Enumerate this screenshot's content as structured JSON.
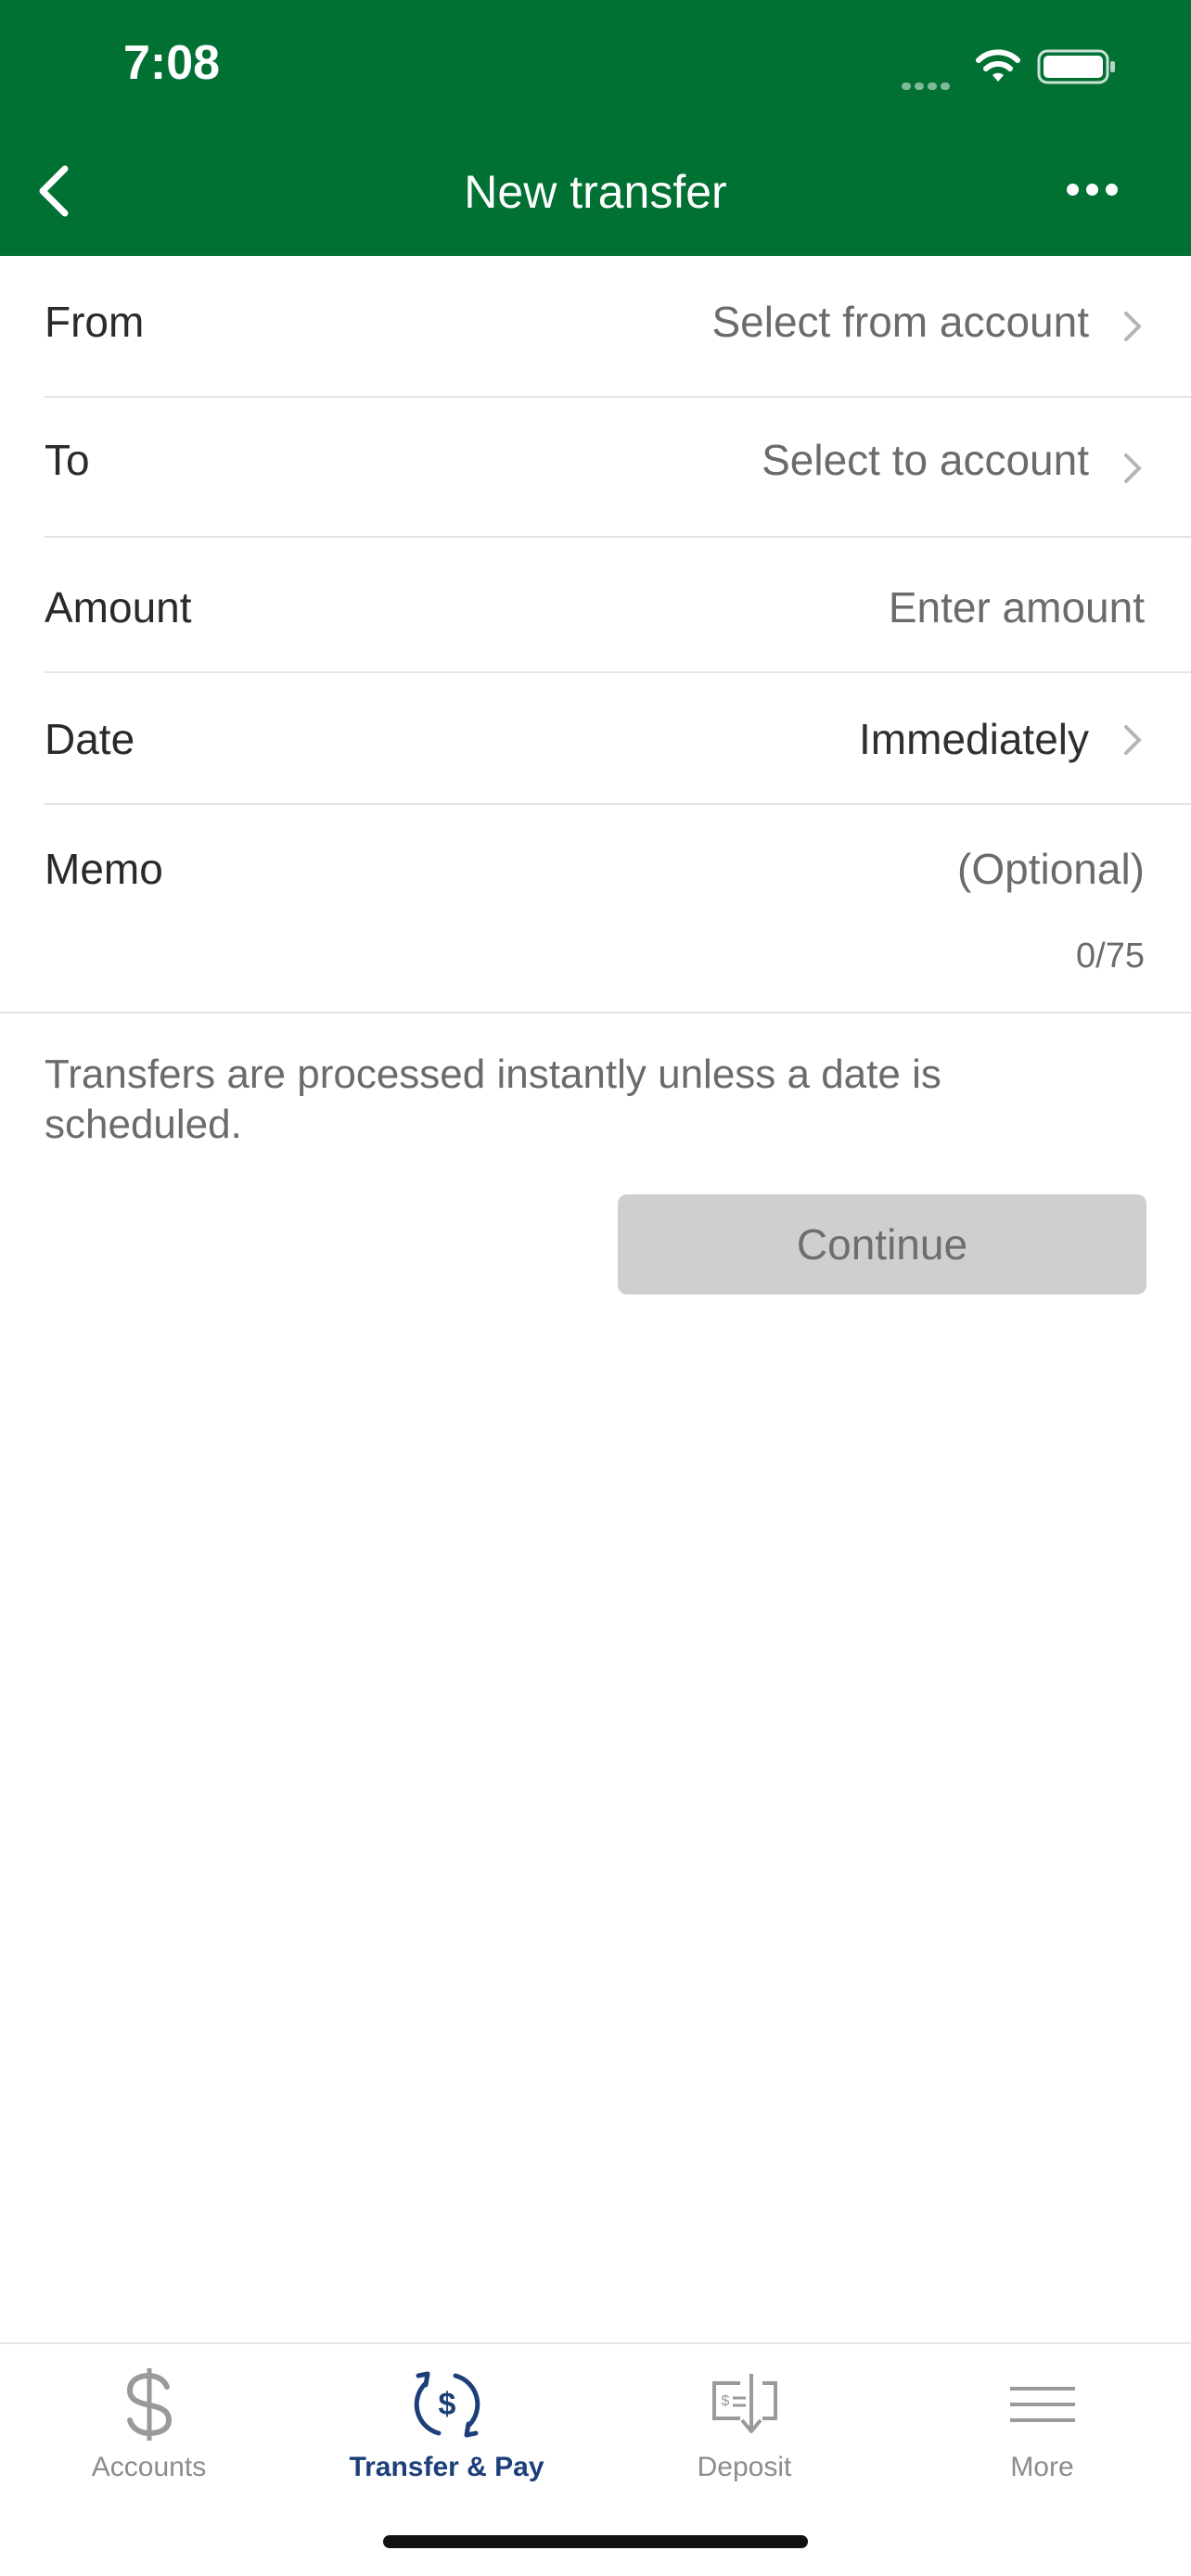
{
  "status_bar": {
    "time": "7:08"
  },
  "nav": {
    "title": "New transfer"
  },
  "form": {
    "from": {
      "label": "From",
      "value": "Select from account"
    },
    "to": {
      "label": "To",
      "value": "Select to account"
    },
    "amount": {
      "label": "Amount",
      "placeholder": "Enter amount"
    },
    "date": {
      "label": "Date",
      "value": "Immediately"
    },
    "memo": {
      "label": "Memo",
      "placeholder": "(Optional)",
      "counter": "0/75"
    }
  },
  "info_text": "Transfers are processed instantly unless a date is scheduled.",
  "continue_label": "Continue",
  "tabs": [
    {
      "label": "Accounts",
      "icon": "dollar-icon",
      "active": false
    },
    {
      "label": "Transfer & Pay",
      "icon": "transfer-pay-icon",
      "active": true
    },
    {
      "label": "Deposit",
      "icon": "deposit-check-icon",
      "active": false
    },
    {
      "label": "More",
      "icon": "menu-icon",
      "active": false
    }
  ],
  "colors": {
    "header": "#007033",
    "active_tab": "#1c3f7a",
    "button_disabled": "#cfcfcf"
  }
}
